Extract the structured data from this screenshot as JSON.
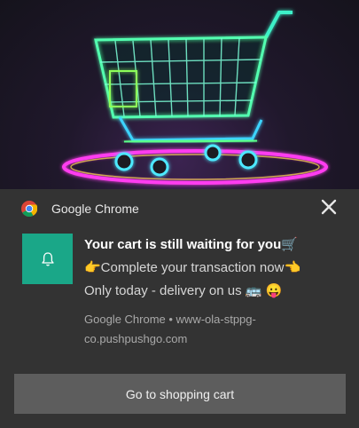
{
  "notification": {
    "app_name": "Google Chrome",
    "title": "Your cart is still waiting for you🛒",
    "body_line1": "👉Complete your transaction now👈",
    "body_line2": "Only today - delivery on us 🚌 😛",
    "source": "Google Chrome • www-ola-stppg-co.pushpushgo.com",
    "action_label": "Go to shopping cart",
    "icons": {
      "app": "chrome-icon",
      "close": "close-icon",
      "thumbnail": "bell-icon",
      "hero": "shopping-cart-neon-image"
    },
    "colors": {
      "panel": "#333333",
      "thumbnail_bg": "#1aa788",
      "button_bg": "#5d5d5d"
    }
  }
}
